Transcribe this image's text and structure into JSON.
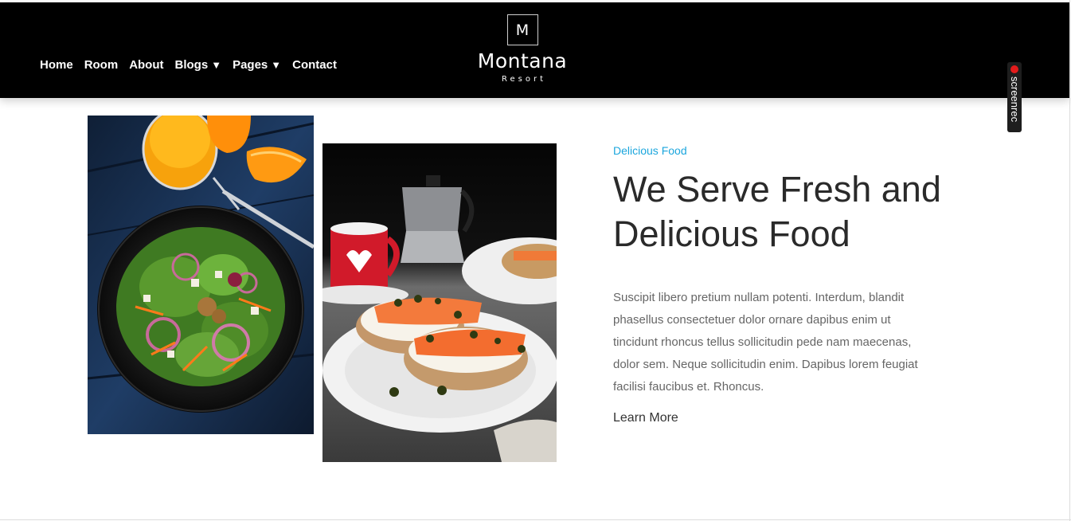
{
  "nav": {
    "items": [
      {
        "label": "Home",
        "dropdown": false
      },
      {
        "label": "Room",
        "dropdown": false
      },
      {
        "label": "About",
        "dropdown": false
      },
      {
        "label": "Blogs",
        "dropdown": true
      },
      {
        "label": "Pages",
        "dropdown": true
      },
      {
        "label": "Contact",
        "dropdown": false
      }
    ],
    "caret": "▼"
  },
  "logo": {
    "letter": "M",
    "name": "Montana",
    "sub": "Resort"
  },
  "recorder": {
    "label": "screenrec"
  },
  "content": {
    "tagline": "Delicious Food",
    "title_line1": "We Serve Fresh and",
    "title_line2": "Delicious Food",
    "paragraph": "Suscipit libero pretium nullam potenti. Interdum, blandit phasellus consectetuer dolor ornare dapibus enim ut tincidunt rhoncus tellus sollicitudin pede nam maecenas, dolor sem. Neque sollicitudin enim. Dapibus lorem feugiat facilisi faucibus et. Rhoncus.",
    "cta": "Learn More"
  },
  "images": {
    "left": "salad-bowl-with-orange-juice-photo",
    "right": "salmon-toast-with-coffee-photo"
  },
  "colors": {
    "header_bg": "#000000",
    "accent": "#1ba6dd",
    "title": "#2a2a2a",
    "body": "#666666"
  }
}
